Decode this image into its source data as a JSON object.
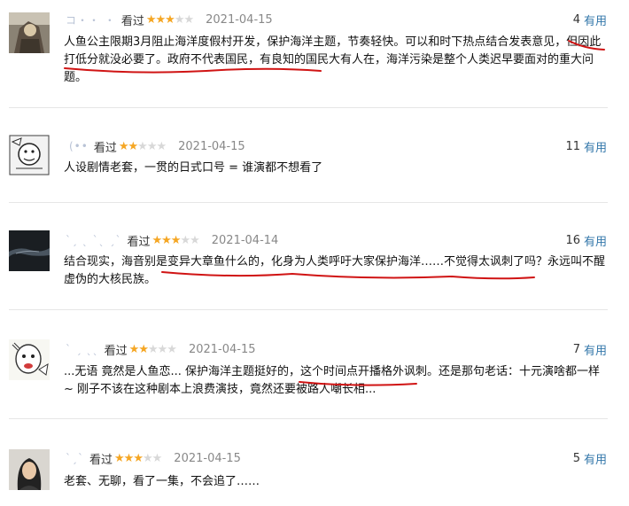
{
  "reviews": [
    {
      "user": "コ・・ ・",
      "watched": "看过",
      "rating": 3,
      "date": "2021-04-15",
      "votes": "4",
      "useful": "有用",
      "content": "人鱼公主限期3月阻止海洋度假村开发，保护海洋主题，节奏轻快。可以和时下热点结合发表意见，但因此打低分就没必要了。政府不代表国民，有良知的国民大有人在，海洋污染是整个人类迟早要面对的重大问题。"
    },
    {
      "user": "(••",
      "watched": "看过",
      "rating": 2,
      "date": "2021-04-15",
      "votes": "11",
      "useful": "有用",
      "content": "人设剧情老套，一贯的日式口号 = 谁演都不想看了"
    },
    {
      "user": "ˋˏ ˎ ˋˎ ˏˋ",
      "watched": "看过",
      "rating": 3,
      "date": "2021-04-14",
      "votes": "16",
      "useful": "有用",
      "content": "结合现实，海音别是变异大章鱼什么的，化身为人类呼吁大家保护海洋……不觉得太讽刺了吗？永远叫不醒虚伪的大核民族。"
    },
    {
      "user": "ˋ ˏ  ˎˎ",
      "watched": "看过",
      "rating": 2,
      "date": "2021-04-15",
      "votes": "7",
      "useful": "有用",
      "content": "...无语 竟然是人鱼恋... 保护海洋主题挺好的，这个时间点开播格外讽刺。还是那句老话：十元演啥都一样 ~ 刚子不该在这种剧本上浪费演技，竟然还要被路人嘲长相..."
    },
    {
      "user": "ˋˏˋ",
      "watched": "看过",
      "rating": 3,
      "date": "2021-04-15",
      "votes": "5",
      "useful": "有用",
      "content": "老套、无聊，看了一集，不会追了……"
    }
  ]
}
